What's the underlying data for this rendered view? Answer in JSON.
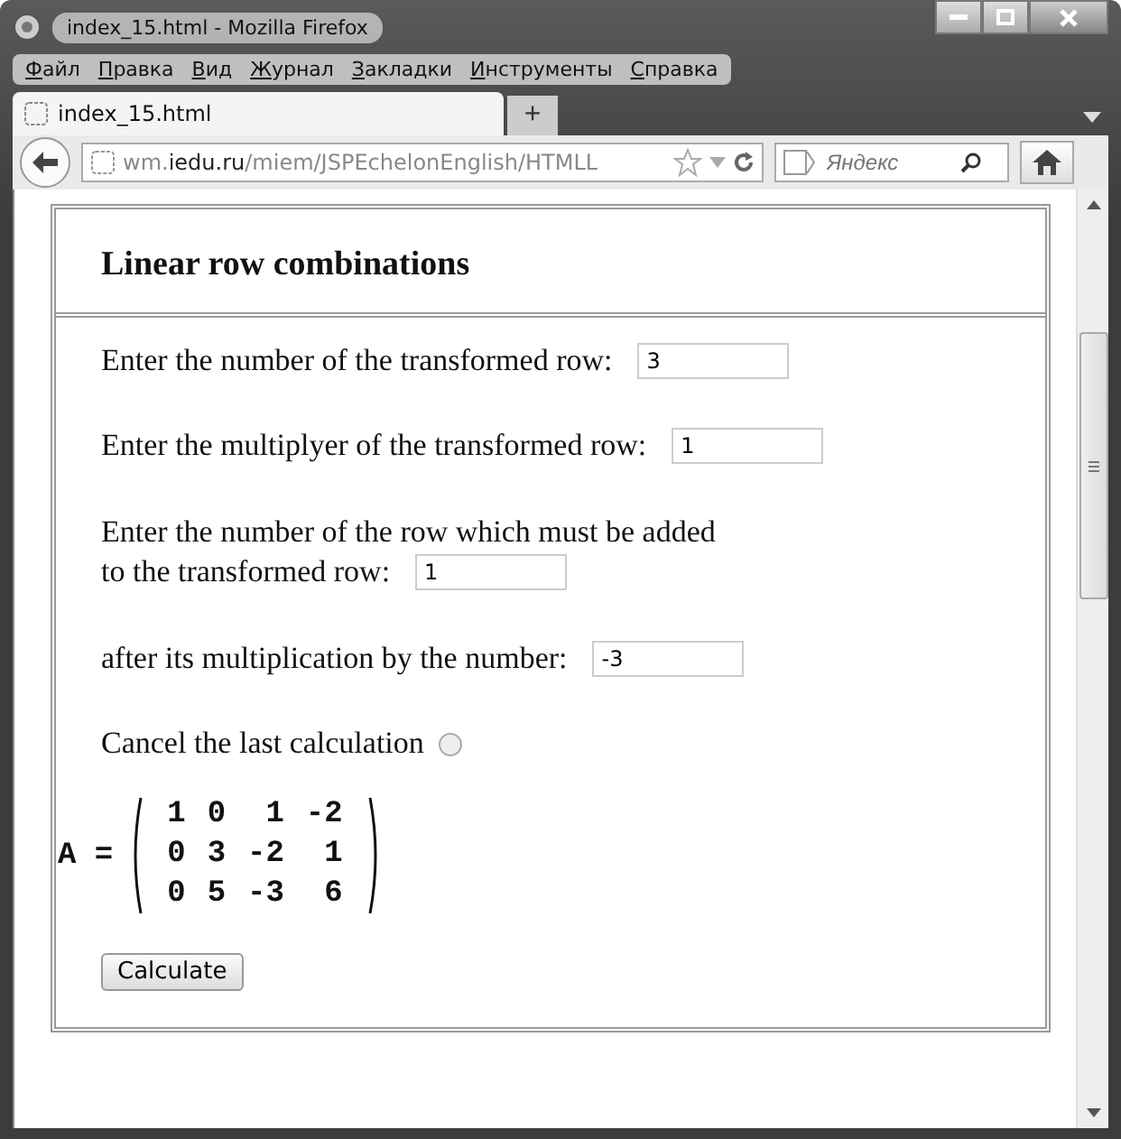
{
  "window": {
    "title": "index_15.html - Mozilla Firefox"
  },
  "menu": [
    "Файл",
    "Правка",
    "Вид",
    "Журнал",
    "Закладки",
    "Инструменты",
    "Справка"
  ],
  "tabs": [
    {
      "label": "index_15.html",
      "selected": true
    }
  ],
  "new_tab": "+",
  "address": {
    "prefix": "wm.",
    "domain": "iedu.ru",
    "path": "/miem/JSPEchelonEnglish/HTMLL"
  },
  "search": {
    "placeholder": "Яндекс"
  },
  "page": {
    "heading": "Linear row combinations",
    "fields": [
      {
        "label": "Enter the number of the transformed row:",
        "value": "3"
      },
      {
        "label": "Enter the multiplyer of the transformed row:",
        "value": "1"
      },
      {
        "label": "Enter the number of the row which must be added",
        "label_2": "to the transformed row:",
        "value": "1"
      },
      {
        "label": "after its multiplication by the number:",
        "value": "-3"
      }
    ],
    "cancel": {
      "label": "Cancel the last calculation",
      "checked": false
    },
    "matrix": {
      "label": "A =",
      "rows": [
        [
          "1",
          "0",
          "1",
          "-2"
        ],
        [
          "0",
          "3",
          "-2",
          "1"
        ],
        [
          "0",
          "5",
          "-3",
          "6"
        ]
      ]
    },
    "button": "Calculate"
  }
}
